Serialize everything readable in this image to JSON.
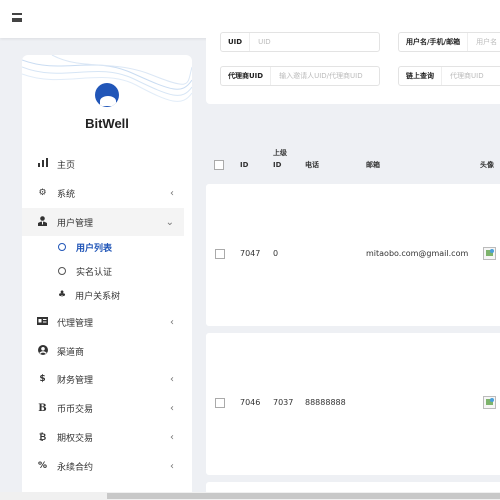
{
  "topbar": {
    "menu_icon": "hamburger-icon"
  },
  "filters": [
    {
      "label": "UID",
      "placeholder": "UID"
    },
    {
      "label": "用户名/手机/邮箱",
      "placeholder": "用户名"
    },
    {
      "label": "代理商UID",
      "placeholder": "输入邀请人UID/代理商UID"
    },
    {
      "label": "链上查询",
      "placeholder": "代理商UID"
    }
  ],
  "sidebar": {
    "brand": "BitWell",
    "items": [
      {
        "label": "主页",
        "icon": "bar-chart-icon",
        "has_arrow": false
      },
      {
        "label": "系统",
        "icon": "gear-icon",
        "has_arrow": true
      },
      {
        "label": "用户管理",
        "icon": "user-tie-icon",
        "has_arrow": true,
        "expanded": true
      },
      {
        "label": "代理管理",
        "icon": "id-card-icon",
        "has_arrow": true
      },
      {
        "label": "渠道商",
        "icon": "user-circle-icon",
        "has_arrow": false
      },
      {
        "label": "财务管理",
        "icon": "dollar-icon",
        "has_arrow": true
      },
      {
        "label": "币币交易",
        "icon": "bitcoin-b-icon",
        "has_arrow": true
      },
      {
        "label": "期权交易",
        "icon": "bitcoin-icon",
        "has_arrow": true
      },
      {
        "label": "永续合约",
        "icon": "percent-icon",
        "has_arrow": true
      }
    ],
    "subitems": [
      {
        "label": "用户列表",
        "icon": "circle-icon",
        "current": true
      },
      {
        "label": "实名认证",
        "icon": "circle-icon",
        "current": false
      },
      {
        "label": "用户关系树",
        "icon": "tree-icon",
        "current": false
      }
    ]
  },
  "table": {
    "columns": [
      "ID",
      "上级",
      "ID",
      "电话",
      "邮箱",
      "头像"
    ],
    "rows": [
      {
        "id": "7047",
        "parent_id": "0",
        "phone": "",
        "email": "mitaobo.com@gmail.com"
      },
      {
        "id": "7046",
        "parent_id": "7037",
        "phone": "88888888",
        "email": ""
      }
    ]
  },
  "colors": {
    "accent": "#2156b8",
    "background": "#eef0f4"
  }
}
